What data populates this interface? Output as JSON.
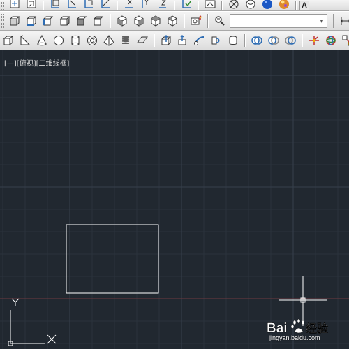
{
  "toolbars": {
    "row1": [
      "views-icon",
      "orbit-icon",
      "ucs-icon",
      "ucs-origin-icon",
      "ucs-axis-icon",
      "ucs-3point-icon",
      "ucs-x-icon",
      "ucs-y-icon",
      "ucs-z-icon",
      "ucs-apply-icon",
      "camera-icon",
      "hide-icon",
      "realistic-icon",
      "material-sphere-icon",
      "light-sphere-icon"
    ],
    "row1_text": "A",
    "row2": [
      "top-view-icon",
      "bottom-view-icon",
      "left-view-icon",
      "right-view-icon",
      "front-view-icon",
      "back-view-icon",
      "sw-iso-icon",
      "se-iso-icon",
      "ne-iso-icon",
      "nw-iso-icon",
      "camera-view-icon",
      "search-layer-icon"
    ],
    "row2_dropdown_value": "",
    "row2_right": [
      "dimension-icon",
      "dim-style-icon"
    ],
    "row3": [
      "box-icon",
      "wedge-icon",
      "cone-icon",
      "sphere-icon",
      "cylinder-icon",
      "torus-icon",
      "pyramid-icon",
      "helix-icon",
      "planar-surface-icon",
      "extrude-icon",
      "presspull-icon",
      "sweep-icon",
      "revolve-icon",
      "loft-icon",
      "union-icon",
      "subtract-icon",
      "intersect-icon",
      "3d-move-icon",
      "3d-rotate-icon",
      "3d-align-icon",
      "3d-array-icon"
    ]
  },
  "viewport": {
    "label": "[—][俯视][二维线框]",
    "background": "#212830",
    "grid_minor_color": "#2a323c",
    "grid_major_color": "#36404c",
    "x_axis_color": "#6e3a40",
    "ucs_x_label": "X",
    "ucs_y_label": "Y",
    "rectangle_color": "#ffffff",
    "crosshair_color": "#ffffff"
  },
  "watermark": {
    "brand": "Bai",
    "brand_suffix": "经验",
    "url": "jingyan.baidu.com"
  }
}
